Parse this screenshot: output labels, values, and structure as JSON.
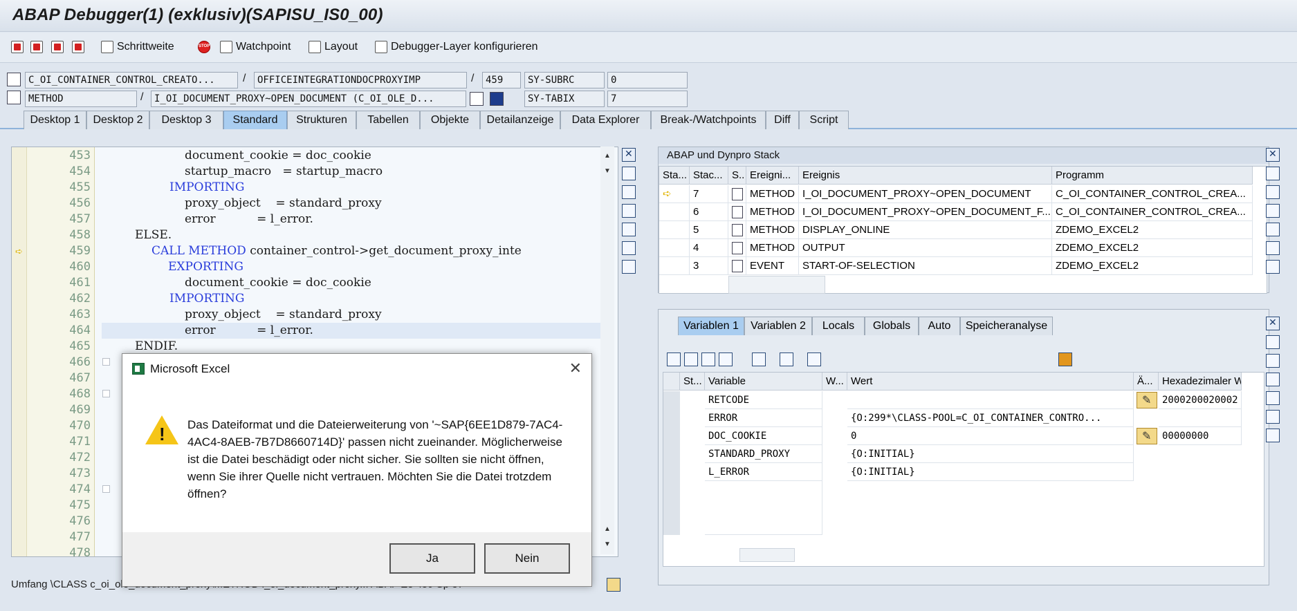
{
  "window_title": "ABAP Debugger(1)  (exklusiv)(SAPISU_IS0_00)",
  "toolbar": {
    "step_size": "Schrittweite",
    "watchpoint": "Watchpoint",
    "layout": "Layout",
    "debugger_layer": "Debugger-Layer  konfigurieren"
  },
  "info": {
    "class": "C_OI_CONTAINER_CONTROL_CREATO...",
    "include": "OFFICEINTEGRATIONDOCPROXYIMP",
    "line": "459",
    "subrc_label": "SY-SUBRC",
    "subrc_value": "0",
    "type": "METHOD",
    "method": "I_OI_DOCUMENT_PROXY~OPEN_DOCUMENT (C_OI_OLE_D...",
    "tabix_label": "SY-TABIX",
    "tabix_value": "7"
  },
  "tabs": [
    "Desktop 1",
    "Desktop 2",
    "Desktop 3",
    "Standard",
    "Strukturen",
    "Tabellen",
    "Objekte",
    "Detailanzeige",
    "Data Explorer",
    "Break-/Watchpoints",
    "Diff",
    "Script"
  ],
  "code": {
    "line_numbers": [
      "453",
      "454",
      "455",
      "456",
      "457",
      "458",
      "459",
      "460",
      "461",
      "462",
      "463",
      "464",
      "465",
      "466",
      "467",
      "468",
      "469",
      "470",
      "471",
      "472",
      "473",
      "474",
      "475",
      "476",
      "477",
      "478"
    ],
    "l453": "document_cookie = doc_cookie",
    "l454": "startup_macro   = startup_macro",
    "l455_kw": "IMPORTING",
    "l456": "proxy_object    = standard_proxy",
    "l457": "error           = l_error.",
    "l458": "ELSE.",
    "l459_kw": "CALL METHOD",
    "l459": " container_control->get_document_proxy_inte",
    "l460_kw": "EXPORTING",
    "l461": "document_cookie = doc_cookie",
    "l462_kw": "IMPORTING",
    "l463": "proxy_object    = standard_proxy",
    "l464": "error           = l_error.",
    "l465": "ENDIF."
  },
  "status": "Umfang \\CLASS c_oi_ole_document_proxy\\METHOD i_oi_document_proxy...  ABAP   Ze 459 Sp 37",
  "stack": {
    "title": "ABAP und Dynpro Stack",
    "headers": [
      "Sta...",
      "Stac...",
      "S..",
      "Ereigni...",
      "Ereignis",
      "Programm"
    ],
    "rows": [
      {
        "level": "7",
        "type": "METHOD",
        "event": "I_OI_DOCUMENT_PROXY~OPEN_DOCUMENT",
        "program": "C_OI_CONTAINER_CONTROL_CREA..."
      },
      {
        "level": "6",
        "type": "METHOD",
        "event": "I_OI_DOCUMENT_PROXY~OPEN_DOCUMENT_F...",
        "program": "C_OI_CONTAINER_CONTROL_CREA..."
      },
      {
        "level": "5",
        "type": "METHOD",
        "event": "DISPLAY_ONLINE",
        "program": "ZDEMO_EXCEL2"
      },
      {
        "level": "4",
        "type": "METHOD",
        "event": "OUTPUT",
        "program": "ZDEMO_EXCEL2"
      },
      {
        "level": "3",
        "type": "EVENT",
        "event": "START-OF-SELECTION",
        "program": "ZDEMO_EXCEL2"
      }
    ]
  },
  "vars": {
    "tabs": [
      "Variablen 1",
      "Variablen 2",
      "Locals",
      "Globals",
      "Auto",
      "Speicheranalyse"
    ],
    "headers": [
      "St...",
      "Variable",
      "W...",
      "Wert",
      "Ä...",
      "Hexadezimaler W"
    ],
    "rows": [
      {
        "name": "RETCODE",
        "value": "",
        "hex": "2000200020002"
      },
      {
        "name": "ERROR",
        "value": "{O:299*\\CLASS-POOL=C_OI_CONTAINER_CONTRO...",
        "hex": ""
      },
      {
        "name": "DOC_COOKIE",
        "value": "0",
        "hex": "00000000"
      },
      {
        "name": "STANDARD_PROXY",
        "value": "{O:INITIAL}",
        "hex": ""
      },
      {
        "name": "L_ERROR",
        "value": "{O:INITIAL}",
        "hex": ""
      }
    ]
  },
  "dialog": {
    "title": "Microsoft Excel",
    "message": "Das Dateiformat und die Dateierweiterung von '~SAP{6EE1D879-7AC4-4AC4-8AEB-7B7D8660714D}' passen nicht zueinander. Möglicherweise ist die Datei beschädigt oder nicht sicher. Sie sollten sie nicht öffnen, wenn Sie ihrer Quelle nicht vertrauen. Möchten Sie die Datei trotzdem öffnen?",
    "yes": "Ja",
    "no": "Nein"
  }
}
